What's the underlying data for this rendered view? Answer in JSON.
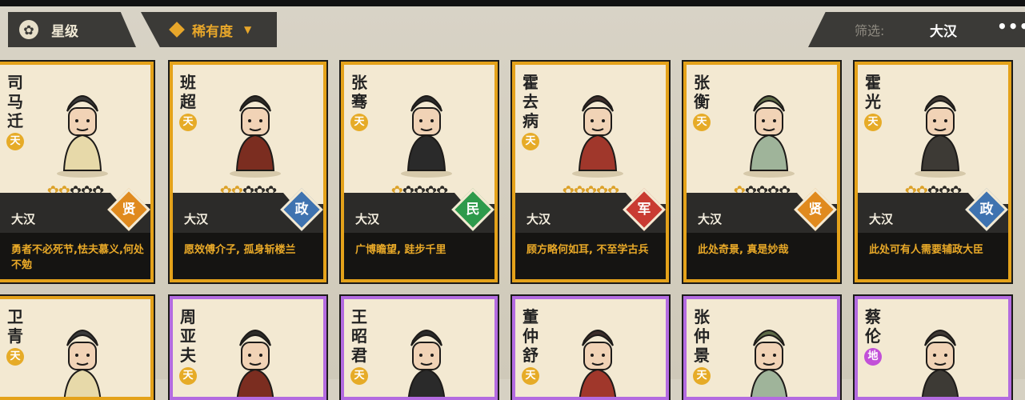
{
  "tabs": {
    "star_label": "星级",
    "rarity_label": "稀有度"
  },
  "filter": {
    "label": "筛选:",
    "value": "大汉",
    "more": "•••"
  },
  "icons": {
    "star_icon": "flower-icon",
    "rarity_icon": "diamond-icon",
    "dropdown_icon": "chevron-down-icon"
  },
  "colors": {
    "gold_border": "#e4a21a",
    "purple_border": "#b36be0",
    "tian_badge": "#e6ab27",
    "di_badge": "#c250d8",
    "xian": "#e08a1e",
    "zheng": "#3f73b0",
    "min": "#2e9a4b",
    "jun": "#c93b32"
  },
  "cards": [
    {
      "name": "司马迁",
      "grade": "天",
      "stars": 2,
      "dynasty": "大汉",
      "role": "贤",
      "desc": "勇者不必死节,怯夫慕义,何处不勉"
    },
    {
      "name": "班超",
      "grade": "天",
      "stars": 2,
      "dynasty": "大汉",
      "role": "政",
      "desc": "愿效傅介子, 孤身斩楼兰"
    },
    {
      "name": "张骞",
      "grade": "天",
      "stars": 1,
      "dynasty": "大汉",
      "role": "民",
      "desc": "广博瞻望, 跬步千里"
    },
    {
      "name": "霍去病",
      "grade": "天",
      "stars": 5,
      "dynasty": "大汉",
      "role": "军",
      "desc": "顾方略何如耳, 不至学古兵"
    },
    {
      "name": "张衡",
      "grade": "天",
      "stars": 1,
      "dynasty": "大汉",
      "role": "贤",
      "desc": "此处奇景, 真是妙哉"
    },
    {
      "name": "霍光",
      "grade": "天",
      "stars": 2,
      "dynasty": "大汉",
      "role": "政",
      "desc": "此处可有人需要辅政大臣"
    },
    {
      "name": "卫青",
      "grade": "天"
    },
    {
      "name": "周亚夫",
      "grade": "天"
    },
    {
      "name": "王昭君",
      "grade": "天"
    },
    {
      "name": "董仲舒",
      "grade": "天"
    },
    {
      "name": "张仲景",
      "grade": "天"
    },
    {
      "name": "蔡伦",
      "grade": "地"
    }
  ]
}
